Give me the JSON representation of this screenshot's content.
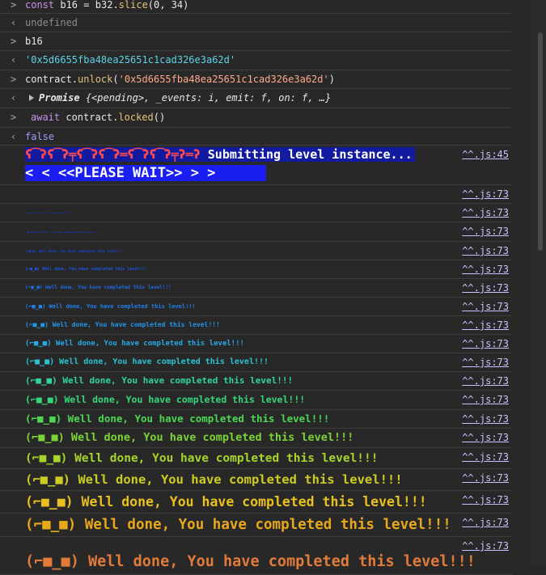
{
  "console": {
    "row1": {
      "kw": "const",
      "varname": "b16",
      "op": "=",
      "obj": "b32",
      "method": "slice",
      "args": "(0, 34)"
    },
    "row2": {
      "text": "undefined"
    },
    "row3": {
      "text": "b16"
    },
    "row4": {
      "text": "'0x5d6655fba48ea25651c1cad326e3a62d'"
    },
    "row5": {
      "obj": "contract",
      "method": "unlock",
      "arg": "'0x5d6655fba48ea25651c1cad326e3a62d'"
    },
    "row6": {
      "label": "Promise",
      "body": "{<pending>, _events: i, emit: f, on: f, …}"
    },
    "row7": {
      "kw": "await",
      "obj": "contract",
      "method": "locked",
      "args": "()"
    },
    "row8": {
      "text": "false"
    },
    "banner": {
      "line1_glitch": "ʕ͡ʔʕ͡ʔ╤ʕ͡ʔʕ͡ʔ═ʕ͡ʔʕ͡ʔ╤ʔ═ʔ",
      "line1_text": "Submitting level instance...",
      "line2_text": "<  < <<PLEASE WAIT>> >  >",
      "source": "^^.js:45"
    },
    "source_73": "^^.js:73",
    "well_done_text": "(⌐■_■) Well done, You have completed this level!!!"
  },
  "colors": {
    "background": "#282828",
    "banner1_bg": "#121aa0",
    "banner2_bg": "#1a1ef0"
  }
}
